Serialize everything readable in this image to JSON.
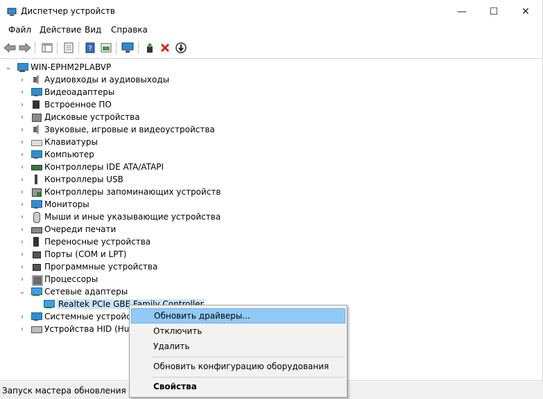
{
  "window": {
    "title": "Диспетчер устройств",
    "minimize": "—",
    "maximize": "☐",
    "close": "✕"
  },
  "menu": [
    "Файл",
    "Действие",
    "Вид",
    "Справка"
  ],
  "tree": {
    "root": "WIN-EPHM2PLABVP",
    "categories": [
      {
        "label": "Аудиовходы и аудиовыходы",
        "icon": "speaker-icon"
      },
      {
        "label": "Видеоадаптеры",
        "icon": "monitor-icon"
      },
      {
        "label": "Встроенное ПО",
        "icon": "chip-icon"
      },
      {
        "label": "Дисковые устройства",
        "icon": "disk-icon"
      },
      {
        "label": "Звуковые, игровые и видеоустройства",
        "icon": "speaker-icon"
      },
      {
        "label": "Клавиатуры",
        "icon": "keyboard-icon"
      },
      {
        "label": "Компьютер",
        "icon": "monitor-icon"
      },
      {
        "label": "Контроллеры IDE ATA/ATAPI",
        "icon": "card-icon"
      },
      {
        "label": "Контроллеры USB",
        "icon": "usb-icon"
      },
      {
        "label": "Контроллеры запоминающих устройств",
        "icon": "storage-icon"
      },
      {
        "label": "Мониторы",
        "icon": "monitor-icon"
      },
      {
        "label": "Мыши и иные указывающие устройства",
        "icon": "mouse-icon"
      },
      {
        "label": "Очереди печати",
        "icon": "printer-icon"
      },
      {
        "label": "Переносные устройства",
        "icon": "phone-icon"
      },
      {
        "label": "Порты (COM и LPT)",
        "icon": "port-icon"
      },
      {
        "label": "Программные устройства",
        "icon": "port-icon"
      },
      {
        "label": "Процессоры",
        "icon": "cpu-icon"
      },
      {
        "label": "Сетевые адаптеры",
        "icon": "network-icon"
      },
      {
        "label": "Realtek PCIe GBE Family Controller",
        "icon": "network-icon"
      },
      {
        "label": "Системные устройства",
        "icon": "monitor-icon"
      },
      {
        "label": "Устройства HID (Hum",
        "icon": "hid-icon"
      }
    ]
  },
  "context_menu": {
    "update_drivers": "Обновить драйверы...",
    "disable": "Отключить",
    "delete": "Удалить",
    "scan_hardware": "Обновить конфигурацию оборудования",
    "properties": "Свойства"
  },
  "status": "Запуск мастера обновления драйверов для выбранного устройства."
}
